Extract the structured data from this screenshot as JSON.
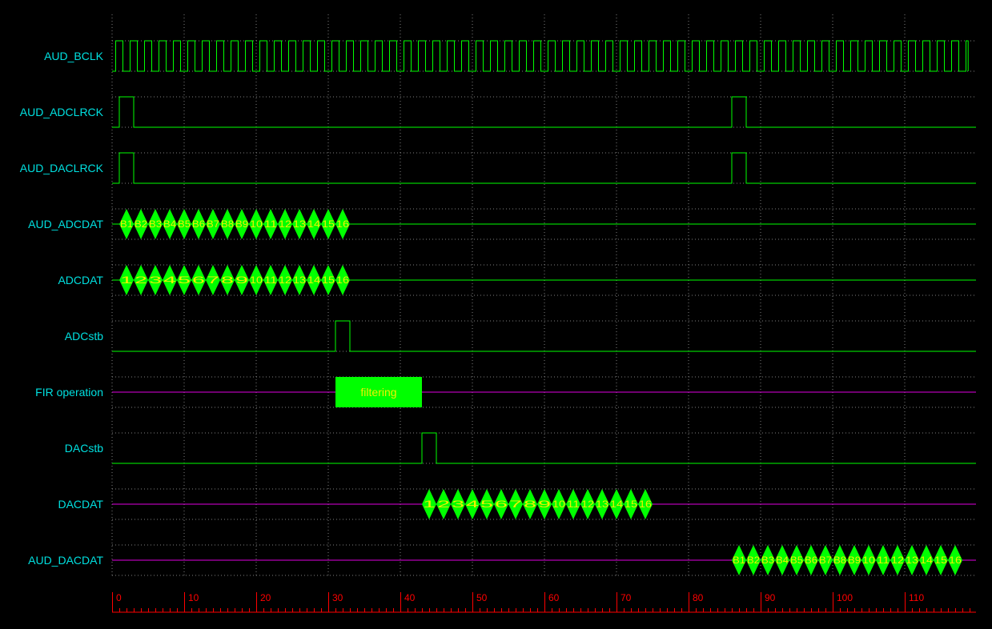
{
  "colors": {
    "background": "#000000",
    "label": "#00e0e0",
    "wave": "#00ff00",
    "idle": "#e000e0",
    "grid": "#808080",
    "axis": "#ff0000",
    "cell_fill": "#00ff00",
    "cell_text": "#f0f000",
    "box_text": "#f0f000"
  },
  "axis": {
    "labels": [
      "0",
      "10",
      "20",
      "30",
      "40",
      "50",
      "60",
      "70",
      "80",
      "90",
      "100",
      "110"
    ]
  },
  "signals": [
    {
      "name": "AUD_BCLK",
      "kind": "clock",
      "period": 2,
      "start": 0.5,
      "end": 118.8
    },
    {
      "name": "AUD_ADCLRCK",
      "kind": "pulses",
      "pulses": [
        [
          1,
          3
        ],
        [
          86,
          88
        ]
      ]
    },
    {
      "name": "AUD_DACLRCK",
      "kind": "pulses",
      "pulses": [
        [
          1,
          3
        ],
        [
          86,
          88
        ]
      ]
    },
    {
      "name": "AUD_ADCDAT",
      "kind": "bus",
      "idle_color": "wave",
      "start": 1,
      "width": 2,
      "cells": [
        "B1",
        "B2",
        "B3",
        "B4",
        "B5",
        "B6",
        "B7",
        "B8",
        "B9",
        "10",
        "11",
        "12",
        "13",
        "14",
        "15",
        "16"
      ]
    },
    {
      "name": "ADCDAT",
      "kind": "bus",
      "idle_color": "wave",
      "start": 1,
      "width": 2,
      "cells": [
        "1",
        "2",
        "3",
        "4",
        "5",
        "6",
        "7",
        "8",
        "9",
        "10",
        "11",
        "12",
        "13",
        "14",
        "15",
        "16"
      ]
    },
    {
      "name": "ADCstb",
      "kind": "pulses",
      "pulses": [
        [
          31,
          33
        ]
      ]
    },
    {
      "name": "FIR operation",
      "kind": "box",
      "start": 31,
      "end": 43,
      "text": "filtering"
    },
    {
      "name": "DACstb",
      "kind": "pulses",
      "pulses": [
        [
          43,
          45
        ]
      ]
    },
    {
      "name": "DACDAT",
      "kind": "bus",
      "idle_color": "idle",
      "start": 43,
      "width": 2,
      "cells": [
        "1",
        "2",
        "3",
        "4",
        "5",
        "6",
        "7",
        "8",
        "9",
        "10",
        "11",
        "12",
        "13",
        "14",
        "15",
        "16"
      ]
    },
    {
      "name": "AUD_DACDAT",
      "kind": "bus",
      "idle_color": "idle",
      "start": 86,
      "width": 2,
      "cells": [
        "B1",
        "B2",
        "B3",
        "B4",
        "B5",
        "B6",
        "B7",
        "B8",
        "B9",
        "10",
        "11",
        "12",
        "13",
        "14",
        "15",
        "16"
      ]
    }
  ]
}
